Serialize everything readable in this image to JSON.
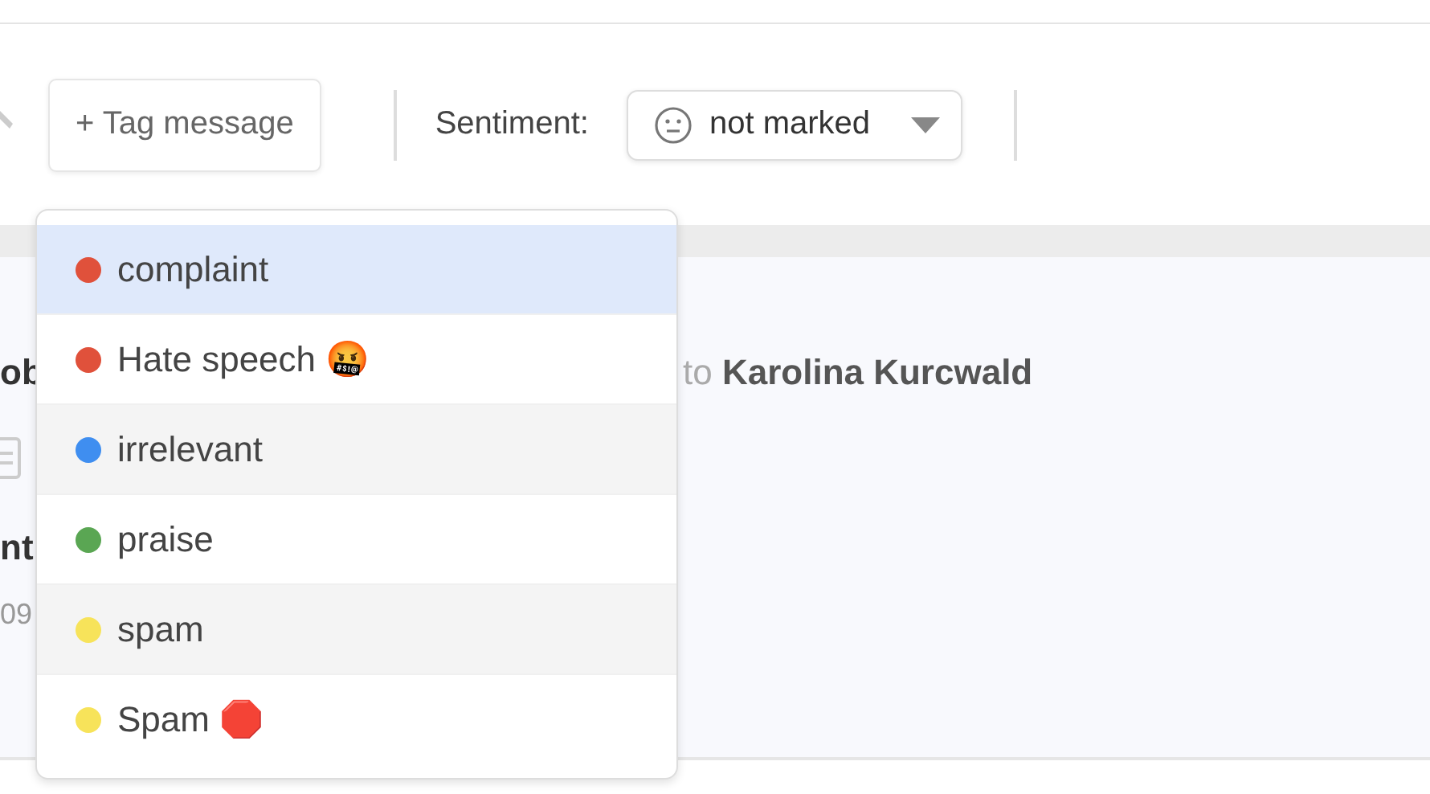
{
  "toolbar": {
    "tag_button": "+ Tag message",
    "sentiment_label": "Sentiment:",
    "sentiment_value": "not marked"
  },
  "message": {
    "author_fragment": "ob",
    "recipient": "to **Karolina Kurcwald**",
    "line_fragment": "nt",
    "time_fragment": "09"
  },
  "tag_menu": [
    {
      "label": "complaint",
      "color": "#e0513b",
      "selected": true
    },
    {
      "label": "Hate speech 🤬",
      "color": "#e0513b",
      "selected": false
    },
    {
      "label": "irrelevant",
      "color": "#3f8ef0",
      "selected": false
    },
    {
      "label": "praise",
      "color": "#5aa653",
      "selected": false
    },
    {
      "label": "spam",
      "color": "#f7e35a",
      "selected": false
    },
    {
      "label": "Spam 🛑",
      "color": "#f7e35a",
      "selected": false
    }
  ]
}
